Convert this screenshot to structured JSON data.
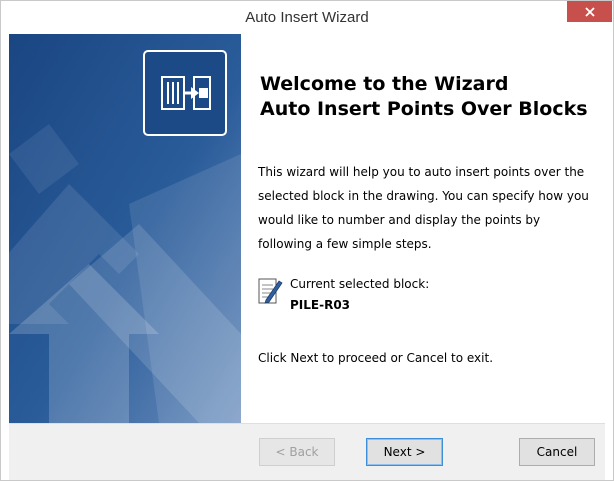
{
  "window": {
    "title": "Auto Insert Wizard"
  },
  "titlebar": {
    "close_icon": "close-icon"
  },
  "banner": {
    "logo_icon": "insert-into-block-icon"
  },
  "content": {
    "heading_line1": "Welcome to the Wizard",
    "heading_line2": "Auto Insert Points Over Blocks",
    "description": "This wizard will help you to auto insert points over the selected block in the drawing. You can specify how you would like to number and display the points by following a few simple steps.",
    "block_icon": "note-pencil-icon",
    "block_label": "Current selected block:",
    "block_name": "PILE-R03",
    "footer_note": "Click Next to proceed or Cancel to exit."
  },
  "buttons": {
    "back": "< Back",
    "next": "Next >",
    "cancel": "Cancel"
  },
  "colors": {
    "banner": "#1f4e8c",
    "close_button": "#c7504d",
    "button_bar": "#f0f0f0",
    "focus_border": "#3c8fd8"
  }
}
